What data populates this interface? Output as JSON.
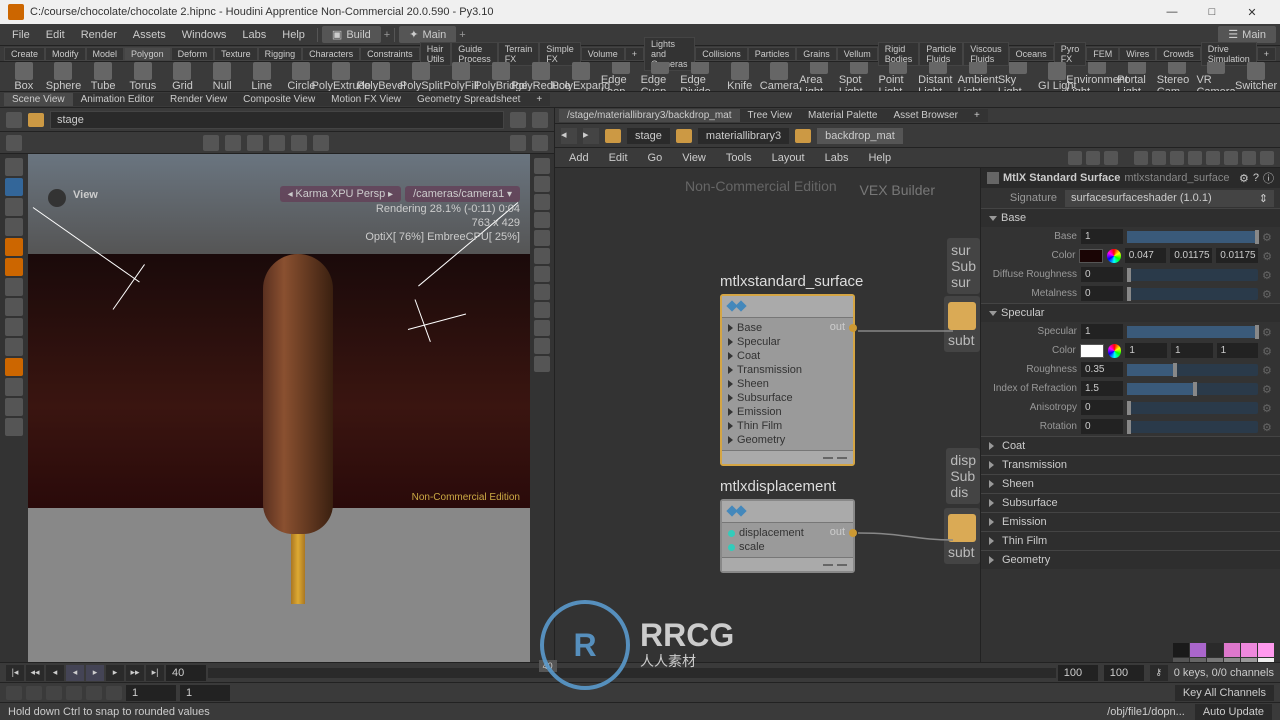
{
  "title": "C:/course/chocolate/chocolate 2.hipnc - Houdini Apprentice Non-Commercial 20.0.590 - Py3.10",
  "menu": {
    "file": "File",
    "edit": "Edit",
    "render": "Render",
    "assets": "Assets",
    "windows": "Windows",
    "labs": "Labs",
    "help": "Help",
    "build": "Build",
    "main": "Main",
    "rtmain": "Main"
  },
  "shelf_tabs_left": [
    "Create",
    "Modify",
    "Model",
    "Polygon",
    "Deform",
    "Texture",
    "Rigging",
    "Characters",
    "Constraints",
    "Hair Utils",
    "Guide Process",
    "Terrain FX",
    "Simple FX",
    "Volume",
    "+"
  ],
  "shelf_tabs_right": [
    "Lights and Cameras",
    "Collisions",
    "Particles",
    "Grains",
    "Vellum",
    "Rigid Bodies",
    "Particle Fluids",
    "Viscous Fluids",
    "Oceans",
    "Pyro FX",
    "FEM",
    "Wires",
    "Crowds",
    "Drive Simulation",
    "+"
  ],
  "shelf_tools_left": [
    "Box",
    "Sphere",
    "Tube",
    "Torus",
    "Grid",
    "Null",
    "Line",
    "Circle",
    "PolyExtrude",
    "PolyBevel",
    "PolySplit",
    "PolyFill",
    "PolyBridge",
    "PolyReduce",
    "PolyExpand",
    "Edge Loop",
    "Edge Cusp",
    "Edge Divide",
    "Knife"
  ],
  "shelf_tools_right": [
    "Camera",
    "Area Light",
    "Spot Light",
    "Point Light",
    "Distant Light",
    "Ambient Light",
    "Sky Light",
    "GI Light",
    "Environment Light",
    "Portal Light",
    "Stereo Cam",
    "VR Camera",
    "Switcher"
  ],
  "panetabs_left": [
    "Scene View",
    "Animation Editor",
    "Render View",
    "Composite View",
    "Motion FX View",
    "Geometry Spreadsheet",
    "+"
  ],
  "panetabs_right": [
    "/stage/materiallibrary3/backdrop_mat",
    "Tree View",
    "Material Palette",
    "Asset Browser",
    "+"
  ],
  "path_left": "stage",
  "path_right": {
    "stage": "stage",
    "mat": "materiallibrary3",
    "bm": "backdrop_mat"
  },
  "viewport": {
    "view": "View",
    "cam1": "Karma XPU Persp",
    "cam2": "/cameras/camera1",
    "stat1": "Rendering  28.1% (-0:11)  0:04",
    "stat2": "763 x 429",
    "stat3": "OptiX[ 76%] EmbreeCPU[ 25%]",
    "nc": "Non-Commercial Edition"
  },
  "netview": {
    "nce": "Non-Commercial Edition",
    "vex": "VEX Builder"
  },
  "node_surface": {
    "title": "mtlxstandard_surface",
    "inputs": [
      "Base",
      "Specular",
      "Coat",
      "Transmission",
      "Sheen",
      "Subsurface",
      "Emission",
      "Thin Film",
      "Geometry"
    ],
    "out": "out"
  },
  "node_disp": {
    "title": "mtlxdisplacement",
    "inputs": [
      "displacement",
      "scale"
    ],
    "out": "out"
  },
  "peeks": {
    "sur": "sur",
    "sub": "Sub",
    "sub2": "subt",
    "disp": "disp",
    "dissub": "Sub",
    "dis2": "dis"
  },
  "parms": {
    "header_type": "MtlX Standard Surface",
    "header_name": "mtlxstandard_surface",
    "sig_label": "Signature",
    "sig_value": "surfacesurfaceshader (1.0.1)",
    "base": {
      "title": "Base",
      "base_lbl": "Base",
      "base_val": "1",
      "color_lbl": "Color",
      "color_r": "0.047",
      "color_g": "0.01175",
      "color_b": "0.01175",
      "drough_lbl": "Diffuse Roughness",
      "drough_val": "0",
      "metal_lbl": "Metalness",
      "metal_val": "0"
    },
    "spec": {
      "title": "Specular",
      "spec_lbl": "Specular",
      "spec_val": "1",
      "color_lbl": "Color",
      "color_r": "1",
      "color_g": "1",
      "color_b": "1",
      "rough_lbl": "Roughness",
      "rough_val": "0.35",
      "ior_lbl": "Index of Refraction",
      "ior_val": "1.5",
      "aniso_lbl": "Anisotropy",
      "aniso_val": "0",
      "rot_lbl": "Rotation",
      "rot_val": "0"
    },
    "groups": [
      "Coat",
      "Transmission",
      "Sheen",
      "Subsurface",
      "Emission",
      "Thin Film",
      "Geometry"
    ]
  },
  "swatch_colors": [
    "#1a1a1a",
    "#aa66cc",
    "#2a2a2a",
    "#dd77cc",
    "#ee88dd",
    "#ff99ee",
    "#555",
    "#666",
    "#777",
    "#888",
    "#999",
    "#eee"
  ],
  "timeline": {
    "frame": "40",
    "end1": "40",
    "end2": "100",
    "end3": "100",
    "keys": "0 keys, 0/0 channels",
    "keyall": "Key All Channels"
  },
  "playbar": {
    "v1": "1",
    "v2": "1",
    "r1": "100",
    "r2": "100"
  },
  "status": {
    "hint": "Hold down Ctrl to snap to rounded values",
    "path": "/obj/file1/dopn...",
    "auto": "Auto Update"
  },
  "rmenu": [
    "Add",
    "Edit",
    "Go",
    "View",
    "Tools",
    "Layout",
    "Labs",
    "Help"
  ],
  "watermark": {
    "main": "RRCG",
    "sub": "人人素材"
  },
  "chart_data": null
}
